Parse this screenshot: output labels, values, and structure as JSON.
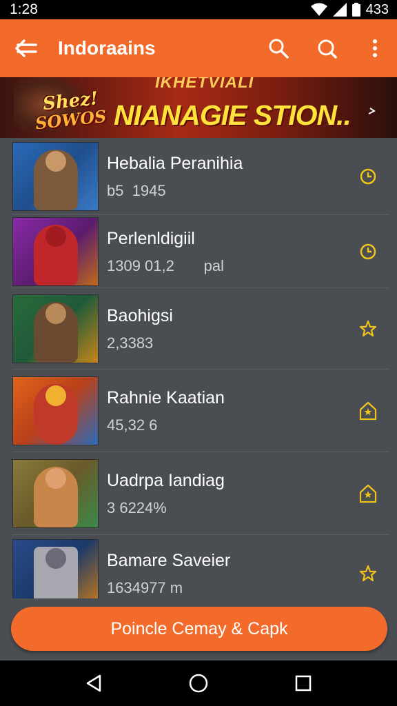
{
  "status_bar": {
    "time": "1:28",
    "right_text": "433"
  },
  "app_bar": {
    "title": "Indoraains",
    "icons": [
      "back-arrow-icon",
      "search-icon",
      "search-icon",
      "overflow-menu-icon"
    ]
  },
  "banner": {
    "badge_line1": "Shez!",
    "badge_line2": "SOWOS",
    "kicker": "IKHETVIALI",
    "headline": "NIANAGIE STION.."
  },
  "items": [
    {
      "name": "Hebalia Peranihia",
      "meta": "b5  1945",
      "action_icon": "clock-icon",
      "thumb_bg": "#1f4f8c",
      "thumb_accent": "#7a5a3a"
    },
    {
      "name": "Perlenldigiil",
      "meta": "1309 01,2       pal",
      "action_icon": "clock-icon",
      "thumb_bg": "#5a1c6e",
      "thumb_accent": "#c0262a"
    },
    {
      "name": "Baohigsi",
      "meta": "2,3383",
      "action_icon": "star-icon",
      "thumb_bg": "#1f5a3a",
      "thumb_accent": "#6a4a30"
    },
    {
      "name": "Rahnie Kaatian",
      "meta": "45,32 6",
      "action_icon": "star-badge-icon",
      "thumb_bg": "#b8401a",
      "thumb_accent": "#c03a2a"
    },
    {
      "name": "Uadrpa Iandiag",
      "meta": "3 6224%",
      "action_icon": "star-badge-icon",
      "thumb_bg": "#6a5a2a",
      "thumb_accent": "#c8864a"
    },
    {
      "name": "Bamare Saveier",
      "meta": "1634977 m",
      "action_icon": "star-icon",
      "thumb_bg": "#1a3a6a",
      "thumb_accent": "#a8a8b0"
    }
  ],
  "cta": {
    "label": "Poincle Cemay & Capk"
  },
  "nav_bar": {
    "icons": [
      "back-triangle-icon",
      "home-circle-icon",
      "recents-square-icon"
    ]
  },
  "colors": {
    "accent": "#f26b2a",
    "background": "#4a4d52",
    "icon_yellow": "#f0c419"
  }
}
